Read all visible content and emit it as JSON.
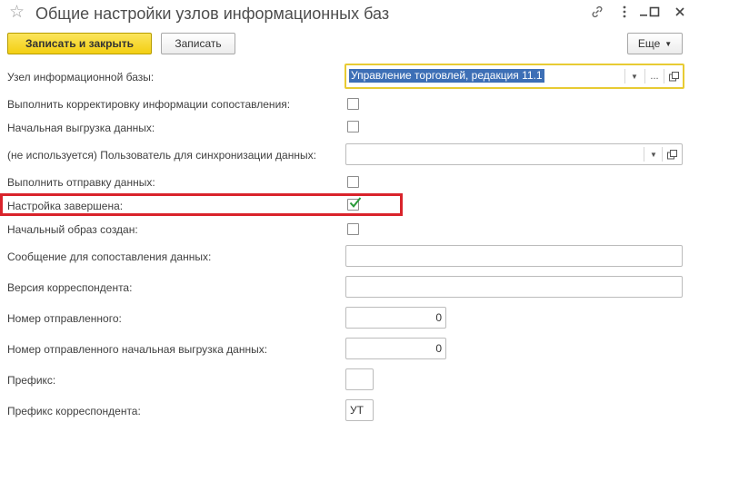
{
  "window": {
    "title": "Общие настройки узлов информационных баз",
    "icons": [
      "star-icon",
      "link-icon",
      "kebab-menu-icon",
      "minimize-icon",
      "maximize-icon",
      "close-icon"
    ]
  },
  "toolbar": {
    "save_close_label": "Записать и закрыть",
    "save_label": "Записать",
    "more_label": "Еще"
  },
  "colors": {
    "primary_button": "#f3cf12",
    "focus_border": "#e8cb33",
    "selection": "#3d6fb6",
    "highlight_frame": "#d9232b",
    "check": "#2a9a3a"
  },
  "form": {
    "node_label": "Узел информационной базы:",
    "node_value": "Управление торговлей, редакция 11.1",
    "correct_matching_label": "Выполнить корректировку информации сопоставления:",
    "correct_matching_checked": false,
    "initial_upload_label": "Начальная выгрузка данных:",
    "initial_upload_checked": false,
    "sync_user_label": "(не используется) Пользователь для синхронизации данных:",
    "sync_user_value": "",
    "send_data_label": "Выполнить отправку данных:",
    "send_data_checked": false,
    "setup_complete_label": "Настройка завершена:",
    "setup_complete_checked": true,
    "initial_image_label": "Начальный образ создан:",
    "initial_image_checked": false,
    "matching_message_label": "Сообщение для сопоставления данных:",
    "matching_message_value": "",
    "correspondent_version_label": "Версия корреспондента:",
    "correspondent_version_value": "",
    "sent_number_label": "Номер отправленного:",
    "sent_number_value": "0",
    "sent_number_initial_label": "Номер отправленного начальная выгрузка данных:",
    "sent_number_initial_value": "0",
    "prefix_label": "Префикс:",
    "prefix_value": "",
    "correspondent_prefix_label": "Префикс корреспондента:",
    "correspondent_prefix_value": "УТ",
    "ellipsis": "..."
  }
}
